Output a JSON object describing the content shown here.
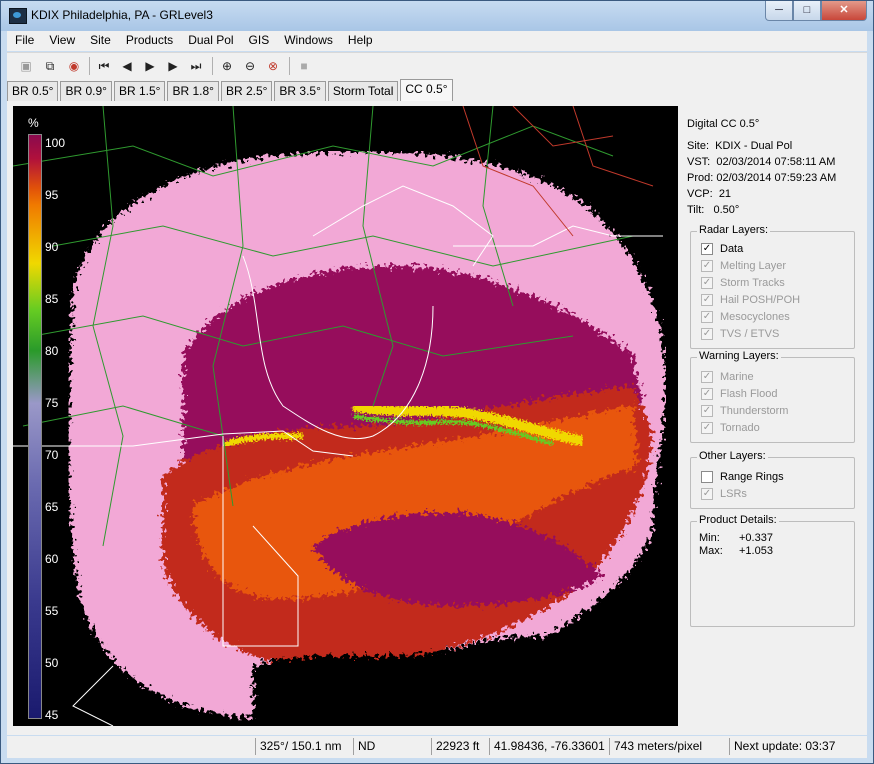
{
  "window": {
    "title": "KDIX Philadelphia, PA - GRLevel3"
  },
  "menu": [
    "File",
    "View",
    "Site",
    "Products",
    "Dual Pol",
    "GIS",
    "Windows",
    "Help"
  ],
  "toolbar_icons": [
    "new-window-icon",
    "copy-icon",
    "record-icon",
    "first-frame-icon",
    "prev-frame-icon",
    "play-icon",
    "next-frame-icon",
    "last-frame-icon",
    "zoom-in-icon",
    "zoom-out-icon",
    "zoom-reset-icon",
    "stop-icon"
  ],
  "tabs": [
    "BR 0.5°",
    "BR 0.9°",
    "BR 1.5°",
    "BR 1.8°",
    "BR 2.5°",
    "BR 3.5°",
    "Storm Total",
    "CC 0.5°"
  ],
  "active_tab": "CC 0.5°",
  "legend": {
    "unit": "%",
    "labels": [
      "100",
      "95",
      "90",
      "85",
      "80",
      "75",
      "70",
      "65",
      "60",
      "55",
      "50",
      "45"
    ]
  },
  "product": {
    "name": "Digital CC 0.5°",
    "site_label": "Site:",
    "site": "KDIX - Dual Pol",
    "vst_label": "VST:",
    "vst": "02/03/2014  07:58:11 AM",
    "prod_label": "Prod:",
    "prod": "02/03/2014  07:59:23 AM",
    "vcp_label": "VCP:",
    "vcp": "21",
    "tilt_label": "Tilt:",
    "tilt": "0.50°"
  },
  "radar_layers": {
    "title": "Radar Layers:",
    "items": [
      {
        "label": "Data",
        "checked": true,
        "enabled": true
      },
      {
        "label": "Melting Layer",
        "checked": true,
        "enabled": false
      },
      {
        "label": "Storm Tracks",
        "checked": true,
        "enabled": false
      },
      {
        "label": "Hail POSH/POH",
        "checked": true,
        "enabled": false
      },
      {
        "label": "Mesocyclones",
        "checked": true,
        "enabled": false
      },
      {
        "label": "TVS / ETVS",
        "checked": true,
        "enabled": false
      }
    ]
  },
  "warning_layers": {
    "title": "Warning Layers:",
    "items": [
      {
        "label": "Marine",
        "checked": true,
        "enabled": false
      },
      {
        "label": "Flash Flood",
        "checked": true,
        "enabled": false
      },
      {
        "label": "Thunderstorm",
        "checked": true,
        "enabled": false
      },
      {
        "label": "Tornado",
        "checked": true,
        "enabled": false
      }
    ]
  },
  "other_layers": {
    "title": "Other Layers:",
    "items": [
      {
        "label": "Range Rings",
        "checked": false,
        "enabled": true
      },
      {
        "label": "LSRs",
        "checked": true,
        "enabled": false
      }
    ]
  },
  "product_details": {
    "title": "Product Details:",
    "min_label": "Min:",
    "min": "+0.337",
    "max_label": "Max:",
    "max": "+1.053"
  },
  "status": {
    "bearing": "325°/ 150.1 nm",
    "value": "ND",
    "height": "22923 ft",
    "coords": "41.98436, -76.33601",
    "scale": "743 meters/pixel",
    "next_update": "Next update: 03:37"
  },
  "colors": {
    "cc_100": "#8a0a4e",
    "cc_95": "#f07a00",
    "cc_90": "#f0d800",
    "cc_85": "#66cc22",
    "cc_80": "#2a9a2a",
    "cc_75": "#9a98c8",
    "cc_45": "#1a1a6e",
    "clutter_pink": "#f2a8d6",
    "core_magenta": "#960f5c"
  }
}
